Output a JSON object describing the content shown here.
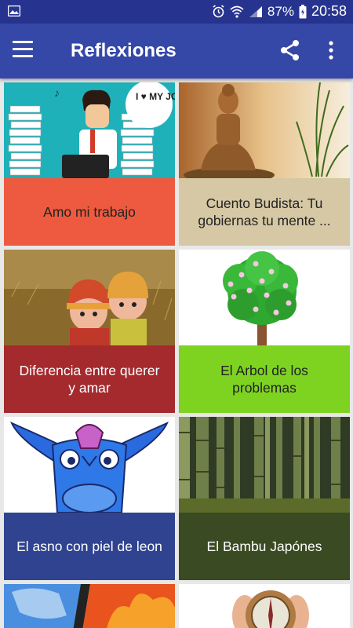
{
  "status_bar": {
    "battery": "87%",
    "time": "20:58",
    "icons": [
      "image-icon",
      "alarm-icon",
      "wifi-icon",
      "signal-icon",
      "battery-icon"
    ]
  },
  "app_bar": {
    "title": "Reflexiones",
    "icons": [
      "menu-icon",
      "share-icon",
      "more-vert-icon"
    ]
  },
  "cards": [
    {
      "title": "Amo mi trabajo",
      "color": "#ee5a3f",
      "image_text": "I ♥ MY JOB"
    },
    {
      "title": "Cuento Budista: Tu gobiernas tu mente ...",
      "color": "#d6c8a4"
    },
    {
      "title": "Diferencia entre querer y amar",
      "color": "#a42a2e"
    },
    {
      "title": "El Arbol de los problemas",
      "color": "#7ed321"
    },
    {
      "title": "El asno con piel de leon",
      "color": "#2f4390"
    },
    {
      "title": "El Bambu Japónes",
      "color": "#3a4a22"
    }
  ]
}
